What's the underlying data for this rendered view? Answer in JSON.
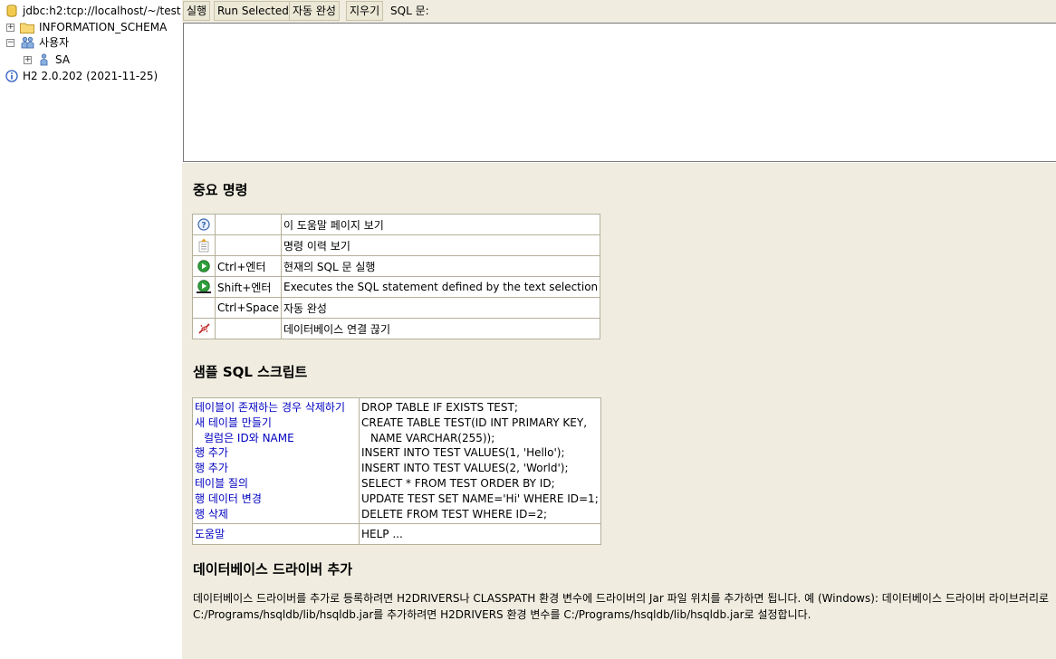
{
  "tree": {
    "connection": "jdbc:h2:tcp://localhost/~/test",
    "schema": "INFORMATION_SCHEMA",
    "users_label": "사용자",
    "user": "SA",
    "version": "H2 2.0.202 (2021-11-25)"
  },
  "toolbar": {
    "run": "실행",
    "run_selected": "Run Selected",
    "autocomplete": "자동 완성",
    "clear": "지우기",
    "sql_label": "SQL 문:"
  },
  "help": {
    "important_title": "중요 명령",
    "commands": [
      {
        "icon": "help-icon",
        "key": "",
        "desc": "이 도움말 페이지 보기"
      },
      {
        "icon": "history-icon",
        "key": "",
        "desc": "명령 이력 보기"
      },
      {
        "icon": "run-icon",
        "key": "Ctrl+엔터",
        "desc": "현재의 SQL 문 실행"
      },
      {
        "icon": "run-selected-icon",
        "key": "Shift+엔터",
        "desc": "Executes the SQL statement defined by the text selection"
      },
      {
        "icon": "",
        "key": "Ctrl+Space",
        "desc": "자동 완성"
      },
      {
        "icon": "disconnect-icon",
        "key": "",
        "desc": "데이터베이스 연결 끊기"
      }
    ],
    "sample_title": "샘플 SQL 스크립트",
    "samples": {
      "left": [
        "테이블이 존재하는 경우 삭제하기",
        "새 테이블 만들기",
        "  컬럼은 ID와 NAME",
        "행 추가",
        "행 추가",
        "테이블 질의",
        "행 데이터 변경",
        "행 삭제"
      ],
      "right": [
        "DROP TABLE IF EXISTS TEST;",
        "CREATE TABLE TEST(ID INT PRIMARY KEY,",
        "   NAME VARCHAR(255));",
        "INSERT INTO TEST VALUES(1, 'Hello');",
        "INSERT INTO TEST VALUES(2, 'World');",
        "SELECT * FROM TEST ORDER BY ID;",
        "UPDATE TEST SET NAME='Hi' WHERE ID=1;",
        "DELETE FROM TEST WHERE ID=2;"
      ],
      "help_left": "도움말",
      "help_right": "HELP ..."
    },
    "driver_title": "데이터베이스 드라이버 추가",
    "driver_text": "데이터베이스 드라이버를 추가로 등록하려면 H2DRIVERS나 CLASSPATH 환경 변수에 드라이버의 Jar 파일 위치를 추가하면 됩니다. 예 (Windows): 데이터베이스 드라이버 라이브러리로 C:/Programs/hsqldb/lib/hsqldb.jar를 추가하려면 H2DRIVERS 환경 변수를 C:/Programs/hsqldb/lib/hsqldb.jar로 설정합니다."
  },
  "colors": {
    "panel_bg": "#f0ede0",
    "link": "#0000c0",
    "border": "#b5b09a"
  }
}
